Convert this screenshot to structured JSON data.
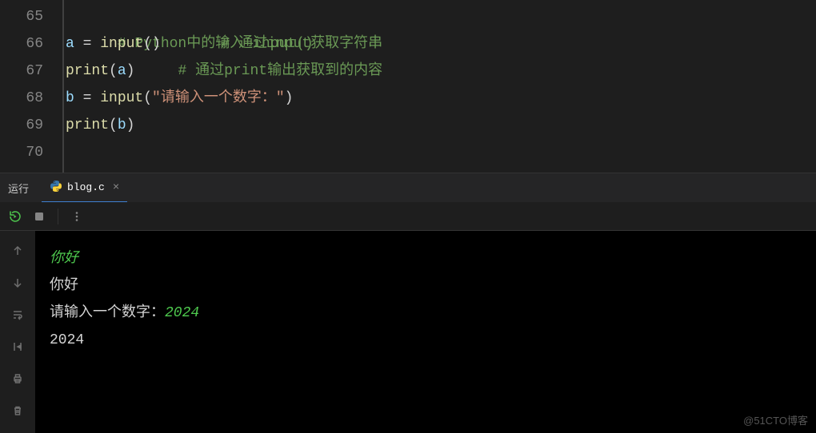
{
  "editor": {
    "gutter": [
      "65",
      "66",
      "67",
      "68",
      "69",
      "70"
    ],
    "lines": {
      "l65": {
        "comment": "# Python中的输入—input()"
      },
      "l66": {
        "var": "a",
        "eq": " = ",
        "fn": "input",
        "p1": "(",
        "p2": ")",
        "spacer": "       ",
        "comment": "# 通过input获取字符串"
      },
      "l67": {
        "fn": "print",
        "p1": "(",
        "arg": "a",
        "p2": ")",
        "spacer": "     ",
        "comment": "# 通过print输出获取到的内容"
      },
      "l68": {
        "var": "b",
        "eq": " = ",
        "fn": "input",
        "p1": "(",
        "str": "\"请输入一个数字：\"",
        "p2": ")"
      },
      "l69": {
        "fn": "print",
        "p1": "(",
        "arg": "b",
        "p2": ")"
      }
    }
  },
  "panel": {
    "title": "运行",
    "tab_name": "blog.c",
    "close": "×"
  },
  "terminal": {
    "row1_input": "你好",
    "row2_output": "你好",
    "row3_prompt": "请输入一个数字：",
    "row3_input": "2024",
    "row4_output": "2024"
  },
  "watermark": "@51CTO博客"
}
